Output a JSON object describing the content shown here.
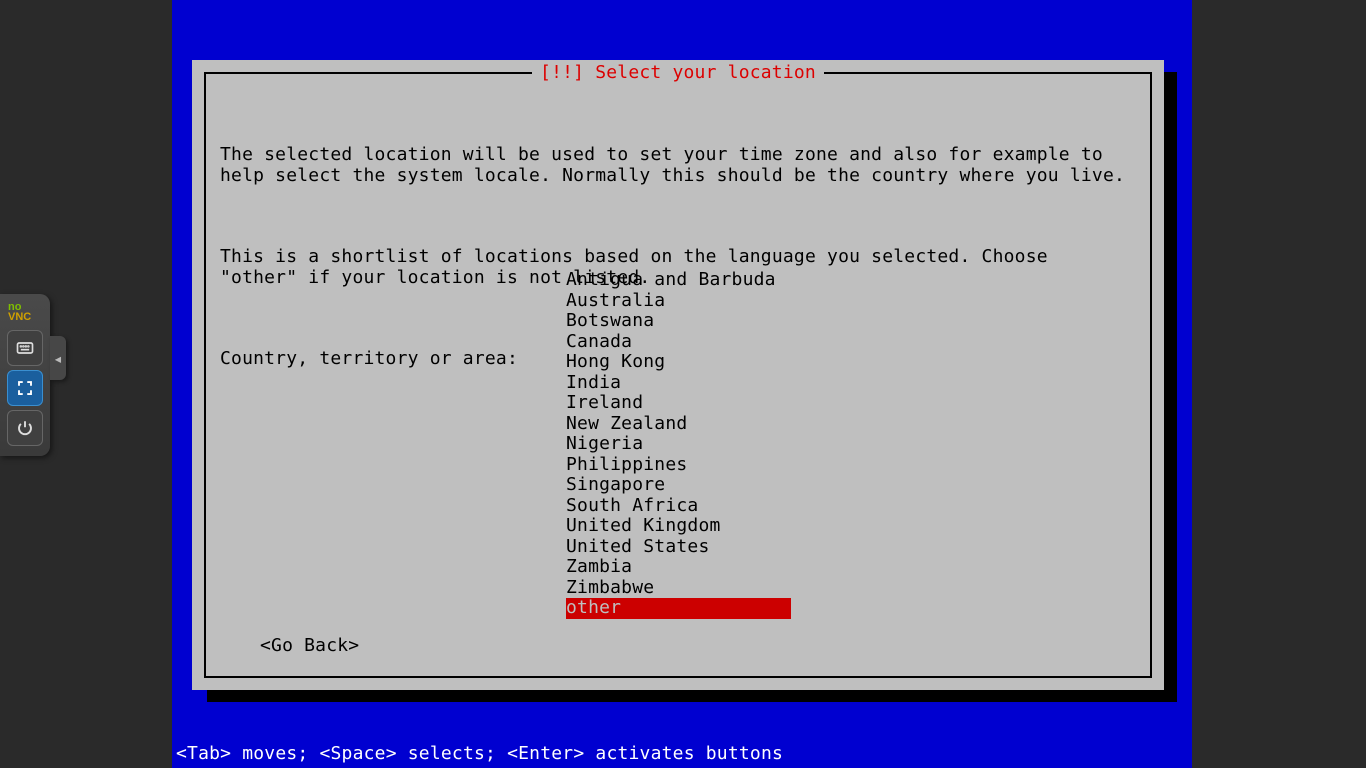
{
  "dialog": {
    "title": "[!!] Select your location",
    "paragraph1": "The selected location will be used to set your time zone and also for example to help select the system locale. Normally this should be the country where you live.",
    "paragraph2": "This is a shortlist of locations based on the language you selected. Choose \"other\" if your location is not listed.",
    "prompt": "Country, territory or area:",
    "options": [
      "Antigua and Barbuda",
      "Australia",
      "Botswana",
      "Canada",
      "Hong Kong",
      "India",
      "Ireland",
      "New Zealand",
      "Nigeria",
      "Philippines",
      "Singapore",
      "South Africa",
      "United Kingdom",
      "United States",
      "Zambia",
      "Zimbabwe",
      "other"
    ],
    "selected_index": 16,
    "go_back": "<Go Back>"
  },
  "help_bar": "<Tab> moves; <Space> selects; <Enter> activates buttons",
  "vnc": {
    "logo_no": "no",
    "logo_vnc": "VNC",
    "handle_glyph": "◂"
  }
}
